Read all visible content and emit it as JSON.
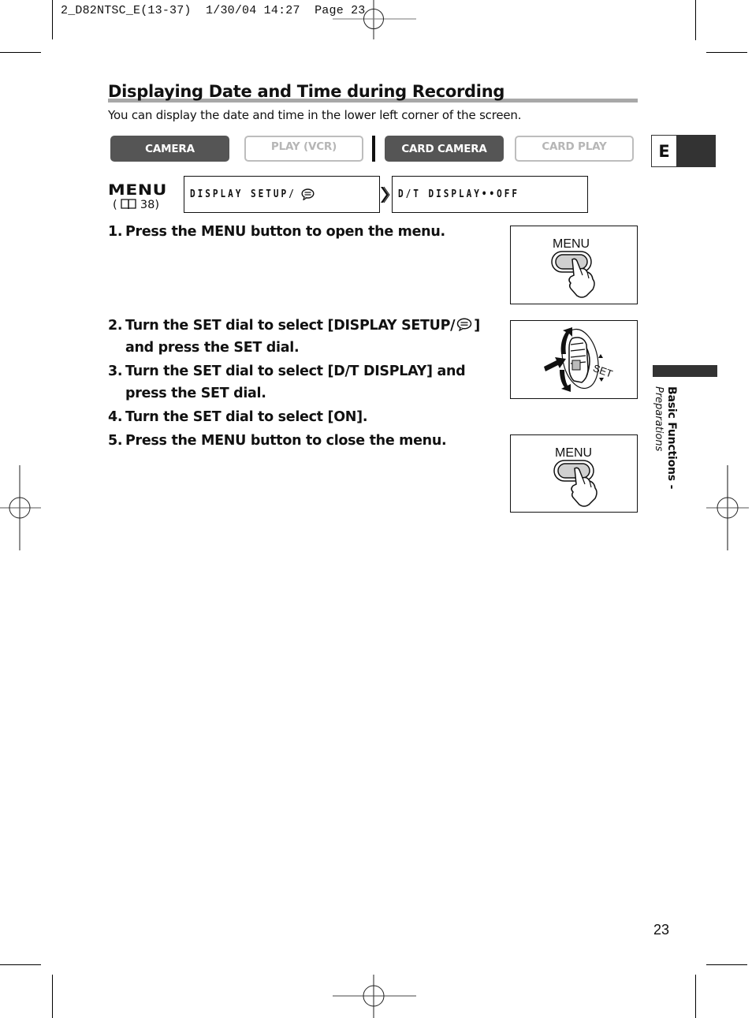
{
  "slug": {
    "file": "2_D82NTSC_E(13-37)",
    "date": "1/30/04",
    "time": "14:27",
    "page_label": "Page 23"
  },
  "section": {
    "title": "Displaying Date and Time during Recording",
    "subtitle": "You can display the date and time in the lower left corner of the screen."
  },
  "modes": [
    {
      "label": "CAMERA",
      "active": true
    },
    {
      "label": "PLAY (VCR)",
      "active": false
    },
    {
      "label": "CARD CAMERA",
      "active": true
    },
    {
      "label": "CARD PLAY",
      "active": false
    }
  ],
  "language_tab": {
    "letter": "E"
  },
  "menu_ref": {
    "logo": "MENU",
    "open_paren": "(",
    "page": "38)",
    "book_icon": "book-icon"
  },
  "menu_path": {
    "item1": "DISPLAY SETUP/",
    "item1_icon": "speech-bubble-icon",
    "arrow_icon": "double-chevron-right-icon",
    "item2": "D/T DISPLAY••OFF"
  },
  "steps": [
    {
      "num": "1.",
      "text": "Press the MENU button to open the menu."
    },
    {
      "num": "2.",
      "text_before_icon": "Turn the SET dial to select [DISPLAY SETUP/",
      "text_after_icon": "] and press the SET dial."
    },
    {
      "num": "3.",
      "text": "Turn the SET dial to select [D/T DISPLAY] and press the SET dial."
    },
    {
      "num": "4.",
      "text": "Turn the SET dial to select [ON]."
    },
    {
      "num": "5.",
      "text": "Press the MENU button to close the menu."
    }
  ],
  "figures": [
    {
      "label": "MENU",
      "type": "menu-button-press"
    },
    {
      "label": "SET",
      "type": "set-dial-turn"
    },
    {
      "label": "MENU",
      "type": "menu-button-press"
    }
  ],
  "side_tab": {
    "chapter": "Basic Functions -",
    "section": "Preparations"
  },
  "page_number": "23"
}
